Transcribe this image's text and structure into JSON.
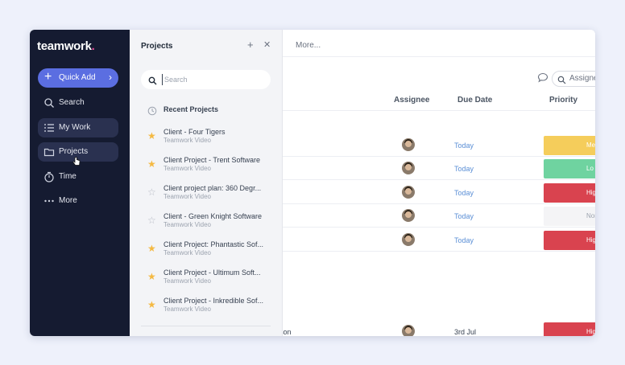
{
  "app": {
    "logo_text": "teamwork",
    "logo_dot": "."
  },
  "sidebar": {
    "quick_add": "Quick Add",
    "items": [
      {
        "label": "Search",
        "icon": "search-icon"
      },
      {
        "label": "My Work",
        "icon": "list-icon",
        "active": true
      },
      {
        "label": "Projects",
        "icon": "folder-icon",
        "active": true
      },
      {
        "label": "Time",
        "icon": "stopwatch-icon"
      },
      {
        "label": "More",
        "icon": "ellipsis-icon"
      }
    ]
  },
  "projects_panel": {
    "title": "Projects",
    "search_placeholder": "Search",
    "recent_label": "Recent Projects",
    "projects": [
      {
        "name": "Client - Four Tigers",
        "sub": "Teamwork Video",
        "starred": true
      },
      {
        "name": "Client Project - Trent Software",
        "sub": "Teamwork Video",
        "starred": true
      },
      {
        "name": "Client project plan: 360 Degr...",
        "sub": "Teamwork Video",
        "starred": false
      },
      {
        "name": "Client - Green Knight Software",
        "sub": "Teamwork Video",
        "starred": false
      },
      {
        "name": "Client Project: Phantastic Sof...",
        "sub": "Teamwork Video",
        "starred": true
      },
      {
        "name": "Client Project - Ultimum Soft...",
        "sub": "Teamwork Video",
        "starred": true
      },
      {
        "name": "Client Project - Inkredible Sof...",
        "sub": "Teamwork Video",
        "starred": true
      }
    ]
  },
  "main": {
    "topbar_more": "More...",
    "assignee_filter": "Assignee",
    "columns": {
      "assignee": "Assignee",
      "due_date": "Due Date",
      "priority": "Priority"
    },
    "rows": [
      {
        "name": "",
        "due": "Today",
        "priority": "Medium",
        "priority_visible": "Med",
        "color": "#f5cd5b"
      },
      {
        "name": "",
        "due": "Today",
        "priority": "Low",
        "priority_visible": "Lo",
        "color": "#6fd3a0"
      },
      {
        "name": "",
        "due": "Today",
        "priority": "High",
        "priority_visible": "Hig",
        "color": "#d9434f"
      },
      {
        "name": "",
        "due": "Today",
        "priority": "None",
        "priority_visible": "Non",
        "color": "#f4f4f6"
      },
      {
        "name": "",
        "due": "Today",
        "priority": "High",
        "priority_visible": "Hig",
        "color": "#d9434f"
      }
    ],
    "bottom_row": {
      "name": "son",
      "due": "3rd Jul",
      "priority_visible": "Hig",
      "color": "#d9434f"
    }
  }
}
